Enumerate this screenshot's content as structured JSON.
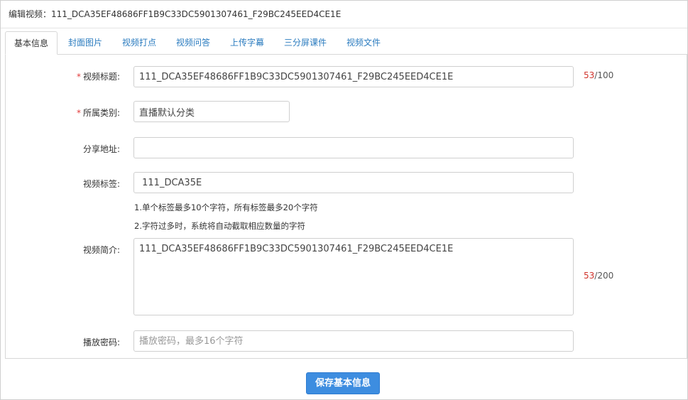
{
  "dialog": {
    "title": "编辑视频：111_DCA35EF48686FF1B9C33DC5901307461_F29BC245EED4CE1E",
    "close_label": "×"
  },
  "tabs": [
    {
      "label": "基本信息",
      "active": true
    },
    {
      "label": "封面图片"
    },
    {
      "label": "视频打点"
    },
    {
      "label": "视频问答"
    },
    {
      "label": "上传字幕"
    },
    {
      "label": "三分屏课件"
    },
    {
      "label": "视频文件"
    }
  ],
  "form": {
    "required_mark": "*",
    "title": {
      "label": "视频标题:",
      "value": "111_DCA35EF48686FF1B9C33DC5901307461_F29BC245EED4CE1E",
      "count": "53",
      "max": "/100"
    },
    "category": {
      "label": "所属类别:",
      "value": "直播默认分类"
    },
    "share": {
      "label": "分享地址:",
      "value": ""
    },
    "tags": {
      "label": "视频标签:",
      "value": " 111_DCA35E",
      "hint1": "1.单个标签最多10个字符，所有标签最多20个字符",
      "hint2": "2.字符过多时，系统将自动截取相应数量的字符"
    },
    "description": {
      "label": "视频简介:",
      "value": "111_DCA35EF48686FF1B9C33DC5901307461_F29BC245EED4CE1E",
      "count": "53",
      "max": "/200"
    },
    "password": {
      "label": "播放密码:",
      "placeholder": "播放密码，最多16个字符",
      "value": ""
    }
  },
  "save_label": "保存基本信息"
}
